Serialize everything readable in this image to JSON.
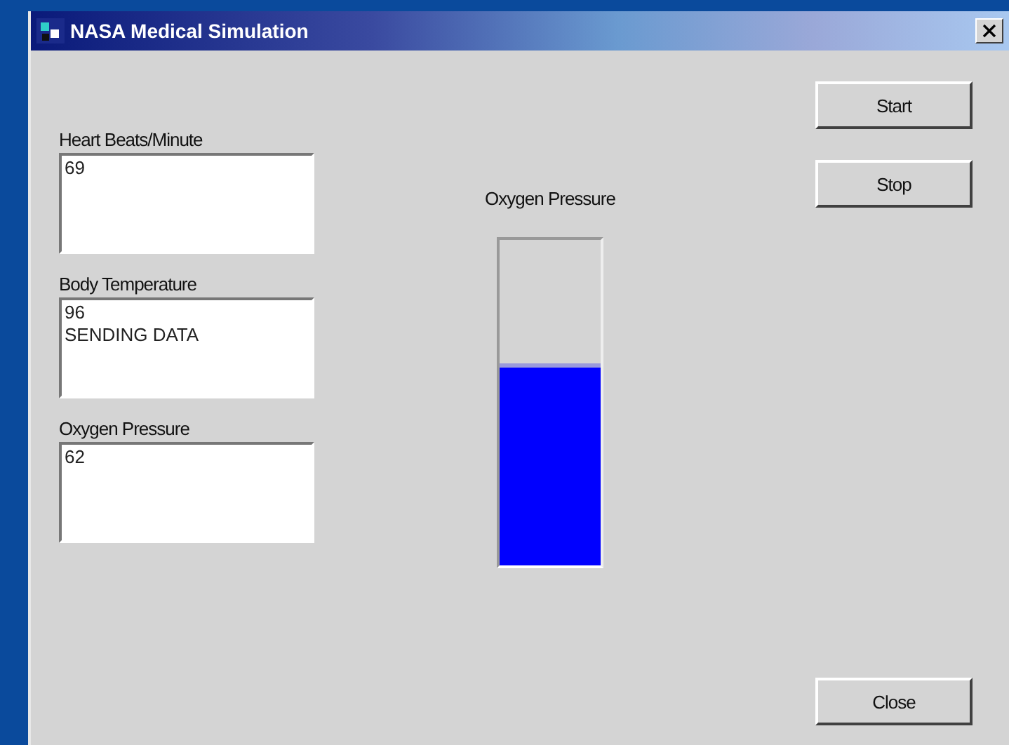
{
  "window": {
    "title": "NASA Medical Simulation"
  },
  "fields": [
    {
      "label": "Heart Beats/Minute",
      "value": "69"
    },
    {
      "label": "Body Temperature",
      "value": "96\nSENDING DATA"
    },
    {
      "label": "Oxygen Pressure",
      "value": "62"
    }
  ],
  "gauge": {
    "label": "Oxygen Pressure",
    "level": 0.62
  },
  "buttons": [
    {
      "label": "Start"
    },
    {
      "label": "Stop"
    }
  ],
  "close_button": {
    "label": "Close"
  }
}
